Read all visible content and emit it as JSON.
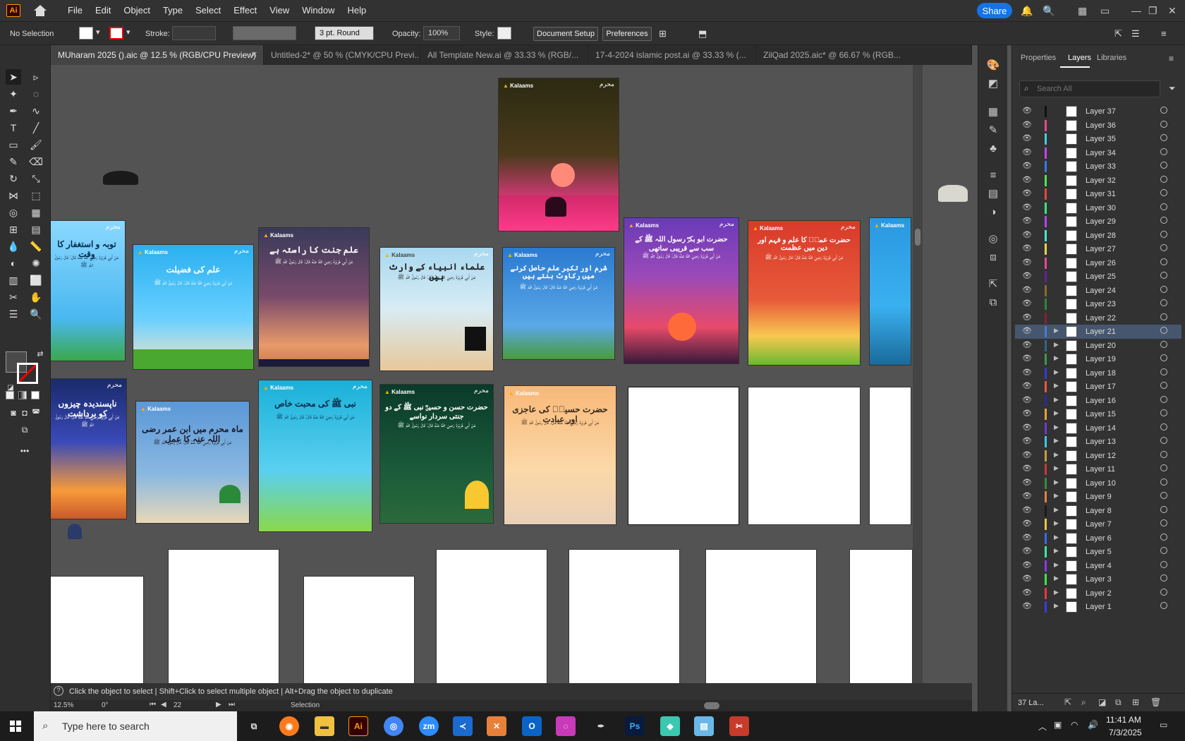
{
  "menubar": {
    "logo": "Ai",
    "items": [
      "File",
      "Edit",
      "Object",
      "Type",
      "Select",
      "Effect",
      "View",
      "Window",
      "Help"
    ],
    "share_label": "Share"
  },
  "controlbar": {
    "selection": "No Selection",
    "stroke_label": "Stroke:",
    "brush": "3 pt. Round",
    "opacity_label": "Opacity:",
    "opacity_value": "100%",
    "style_label": "Style:",
    "document_setup": "Document Setup",
    "preferences": "Preferences"
  },
  "tabs": [
    {
      "label": "MUharam 2025 ().aic @ 12.5 % (RGB/CPU Preview)",
      "active": true
    },
    {
      "label": "Untitled-2* @ 50 % (CMYK/CPU Previ...",
      "active": false
    },
    {
      "label": "All Template New.ai @ 33.33 % (RGB/...",
      "active": false
    },
    {
      "label": "17-4-2024 islamic post.ai @ 33.33 % (...",
      "active": false
    },
    {
      "label": "ZilQad 2025.aic* @ 66.67 % (RGB...",
      "active": false
    }
  ],
  "artboards": {
    "brand": "Kalaams",
    "ornament": "محرم",
    "titles": {
      "r1_1": "توبہ و استغفار کا وقت",
      "r1_2": "علم کی فضیلت",
      "r1_3": "علم جنت کا راستہ ہے",
      "r1_4": "علماء انبیاء کے وارث ہیں",
      "r1_5": "شرم اور تکبر علم حاصل کرنے میں رکاوٹ بنتے ہیں",
      "r1_6": "حضرت ابو بکرؓ رسول اللہ ﷺ کے سب سے قریبی ساتھی",
      "r1_7": "حضرت عمرؓ کا علم و فہم اور دین میں عظمت",
      "r2_1": "ناپسندیدہ چیزوں کو برداشت",
      "r2_2": "ماہ محرم میں ابن عمر رضی اللہ عنہ کا عمل",
      "r2_3": "نبی ﷺ کی محبت خاص",
      "r2_4": "حضرت حسن و حسینؓ نبی ﷺ کے دو جنتی سردار نواسے",
      "r2_5": "حضرت حسینؓ کی عاجزی اور عبادت"
    },
    "body": "عَنْ أَبِي هُرَيْرَةَ رَضِيَ اللهُ عَنْهُ قَالَ: قَالَ رَسُولُ اللهِ ﷺ"
  },
  "layers_panel": {
    "tabs": [
      "Properties",
      "Layers",
      "Libraries"
    ],
    "search_placeholder": "Search All",
    "layers": [
      {
        "name": "Layer 37",
        "color": "#111111",
        "expandable": false
      },
      {
        "name": "Layer 36",
        "color": "#e84a8a",
        "expandable": false
      },
      {
        "name": "Layer 35",
        "color": "#3fd0e0",
        "expandable": false
      },
      {
        "name": "Layer 34",
        "color": "#c845e8",
        "expandable": false
      },
      {
        "name": "Layer 33",
        "color": "#3a78e8",
        "expandable": false
      },
      {
        "name": "Layer 32",
        "color": "#4ce84c",
        "expandable": false
      },
      {
        "name": "Layer 31",
        "color": "#e8483a",
        "expandable": false
      },
      {
        "name": "Layer 30",
        "color": "#36e87a",
        "expandable": false
      },
      {
        "name": "Layer 29",
        "color": "#b048e8",
        "expandable": false
      },
      {
        "name": "Layer 28",
        "color": "#48e8c8",
        "expandable": false
      },
      {
        "name": "Layer 27",
        "color": "#e8d648",
        "expandable": false
      },
      {
        "name": "Layer 26",
        "color": "#e84890",
        "expandable": false
      },
      {
        "name": "Layer 25",
        "color": "#6a1f9a",
        "expandable": false
      },
      {
        "name": "Layer 24",
        "color": "#8a6a2a",
        "expandable": false
      },
      {
        "name": "Layer 23",
        "color": "#2a8a3a",
        "expandable": false
      },
      {
        "name": "Layer 22",
        "color": "#8a1f3a",
        "expandable": false
      },
      {
        "name": "Layer 21",
        "color": "#4a7ad0",
        "expandable": true,
        "selected": true
      },
      {
        "name": "Layer 20",
        "color": "#2a6a8a",
        "expandable": true
      },
      {
        "name": "Layer 19",
        "color": "#3a9a4a",
        "expandable": true
      },
      {
        "name": "Layer 18",
        "color": "#3a3ad0",
        "expandable": true
      },
      {
        "name": "Layer 17",
        "color": "#e85a3a",
        "expandable": true
      },
      {
        "name": "Layer 16",
        "color": "#2a2a9a",
        "expandable": true
      },
      {
        "name": "Layer 15",
        "color": "#e8a03a",
        "expandable": true
      },
      {
        "name": "Layer 14",
        "color": "#6a3ad0",
        "expandable": true
      },
      {
        "name": "Layer 13",
        "color": "#3ac8e8",
        "expandable": true
      },
      {
        "name": "Layer 12",
        "color": "#c8a03a",
        "expandable": true
      },
      {
        "name": "Layer 11",
        "color": "#c83a3a",
        "expandable": true
      },
      {
        "name": "Layer 10",
        "color": "#3a8a3a",
        "expandable": true
      },
      {
        "name": "Layer 9",
        "color": "#e8803a",
        "expandable": true
      },
      {
        "name": "Layer 8",
        "color": "#1a1a1a",
        "expandable": true
      },
      {
        "name": "Layer 7",
        "color": "#e8c83a",
        "expandable": true
      },
      {
        "name": "Layer 6",
        "color": "#3a6ae8",
        "expandable": true
      },
      {
        "name": "Layer 5",
        "color": "#3ae8a0",
        "expandable": true
      },
      {
        "name": "Layer 4",
        "color": "#8a3ae8",
        "expandable": true
      },
      {
        "name": "Layer 3",
        "color": "#3ae84a",
        "expandable": true
      },
      {
        "name": "Layer 2",
        "color": "#e83a3a",
        "expandable": true
      },
      {
        "name": "Layer 1",
        "color": "#3a3ae8",
        "expandable": true
      }
    ],
    "footer_count": "37 La..."
  },
  "statusbar": {
    "hint": "Click the object to select  |  Shift+Click to select multiple object  |  Alt+Drag the object to duplicate",
    "zoom": "12.5%",
    "rotation": "0°",
    "artboard_num": "22",
    "mode": "Selection"
  },
  "taskbar": {
    "search_placeholder": "Type here to search",
    "time": "11:41 AM",
    "date": "7/3/2025"
  }
}
